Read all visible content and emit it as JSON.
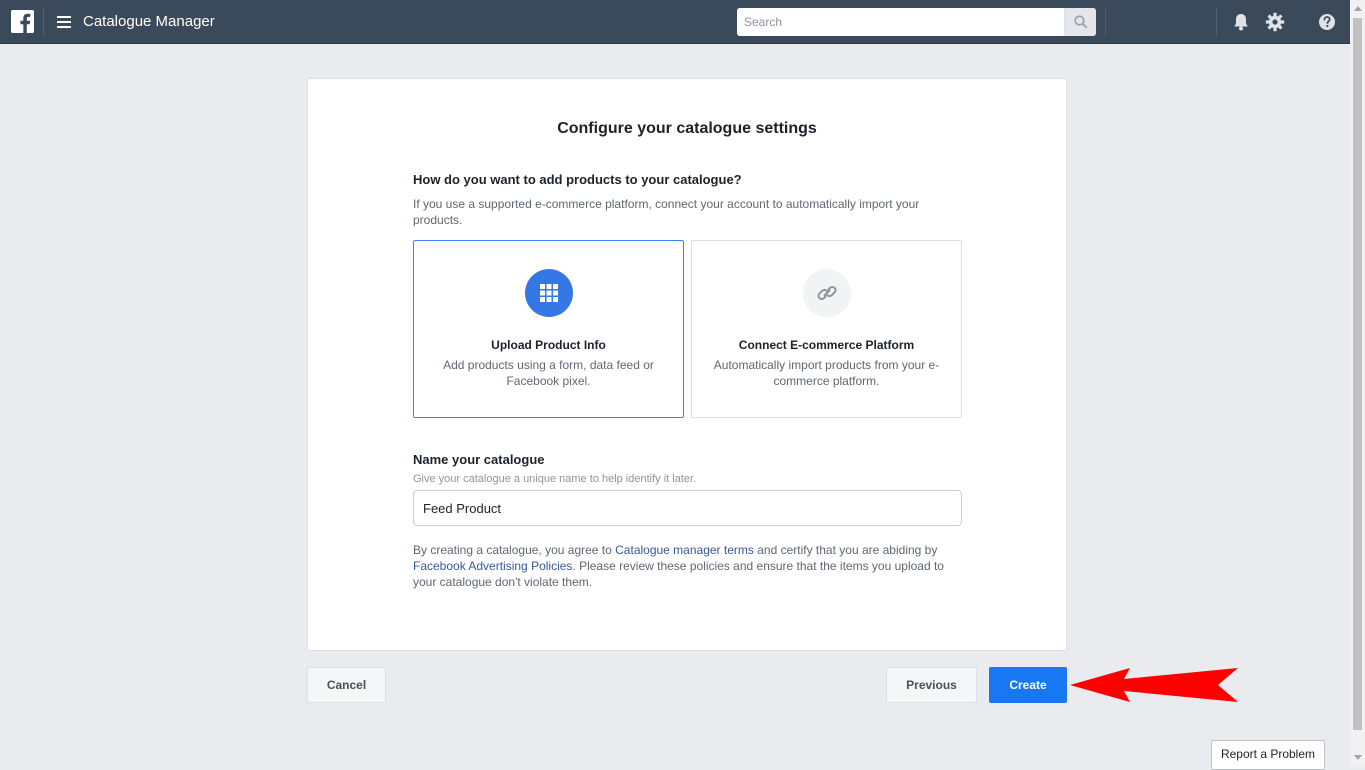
{
  "topbar": {
    "app_title": "Catalogue Manager",
    "search_placeholder": "Search"
  },
  "card": {
    "title": "Configure your catalogue settings",
    "add_products": {
      "question": "How do you want to add products to your catalogue?",
      "description": "If you use a supported e-commerce platform, connect your account to automatically import your products."
    },
    "options": [
      {
        "title": "Upload Product Info",
        "description": "Add products using a form, data feed or Facebook pixel.",
        "icon": "grid-icon",
        "selected": true
      },
      {
        "title": "Connect E-commerce Platform",
        "description": "Automatically import products from your e-commerce platform.",
        "icon": "link-icon",
        "selected": false
      }
    ],
    "name_section": {
      "title": "Name your catalogue",
      "hint": "Give your catalogue a unique name to help identify it later.",
      "value": "Feed Product"
    },
    "legal": {
      "part1": "By creating a catalogue, you agree to ",
      "link1": "Catalogue manager terms",
      "part2": " and certify that you are abiding by ",
      "link2": "Facebook Advertising Policies",
      "part3": ". Please review these policies and ensure that the items you upload to your catalogue don't violate them."
    }
  },
  "footer": {
    "cancel_label": "Cancel",
    "previous_label": "Previous",
    "create_label": "Create",
    "report_label": "Report a Problem"
  },
  "colors": {
    "topbar": "#3b4a5a",
    "primary": "#1877f2",
    "annotation_arrow": "#ff0000"
  }
}
